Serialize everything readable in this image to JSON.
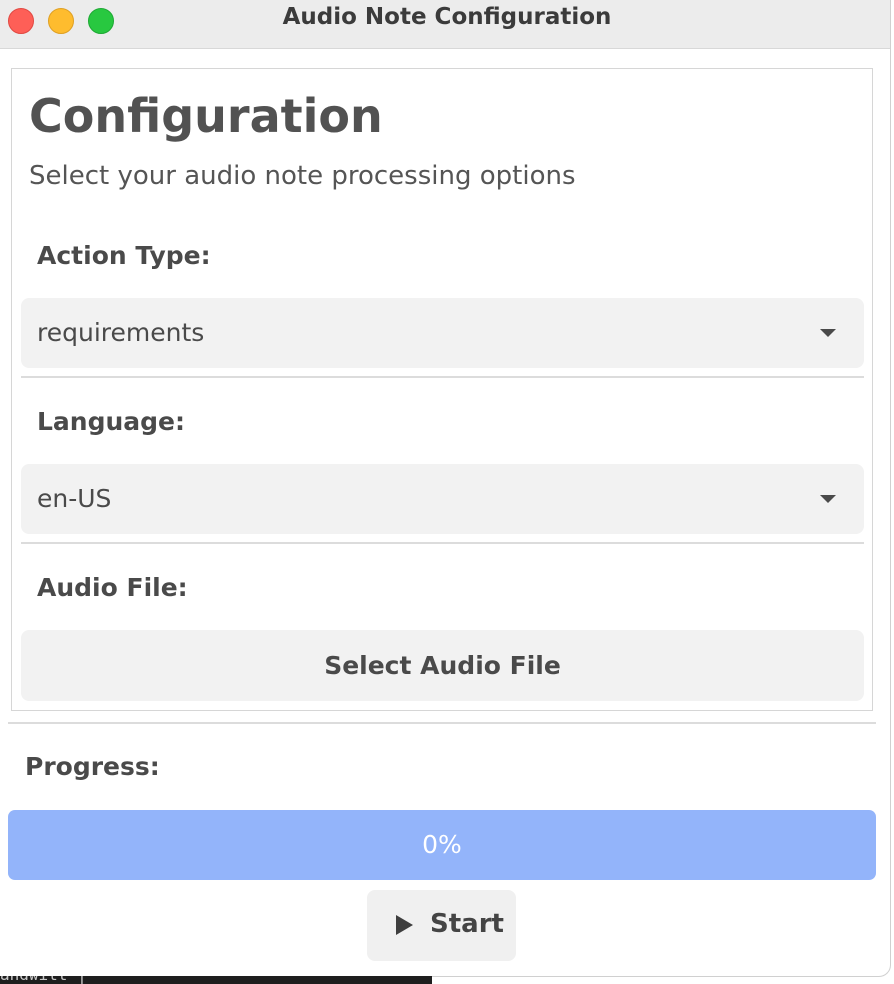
{
  "window": {
    "title": "Audio Note Configuration"
  },
  "header": {
    "title": "Configuration",
    "subtitle": "Select your audio note processing options"
  },
  "fields": {
    "action_type": {
      "label": "Action Type:",
      "value": "requirements"
    },
    "language": {
      "label": "Language:",
      "value": "en-US"
    },
    "audio_file": {
      "label": "Audio File:",
      "button_label": "Select Audio File"
    }
  },
  "progress": {
    "label": "Progress:",
    "value_text": "0%",
    "fraction": 0
  },
  "actions": {
    "start_label": "Start"
  },
  "icons": {
    "start": "play-icon",
    "dropdown": "chevron-down-icon"
  },
  "colors": {
    "progress_track": "#93b4fa",
    "progress_fill": "#4f7ef2",
    "close": "#fe5f57",
    "minimize": "#febc2e",
    "maximize": "#28c840"
  },
  "background_window": {
    "text": "andwitt | ^ ^"
  }
}
